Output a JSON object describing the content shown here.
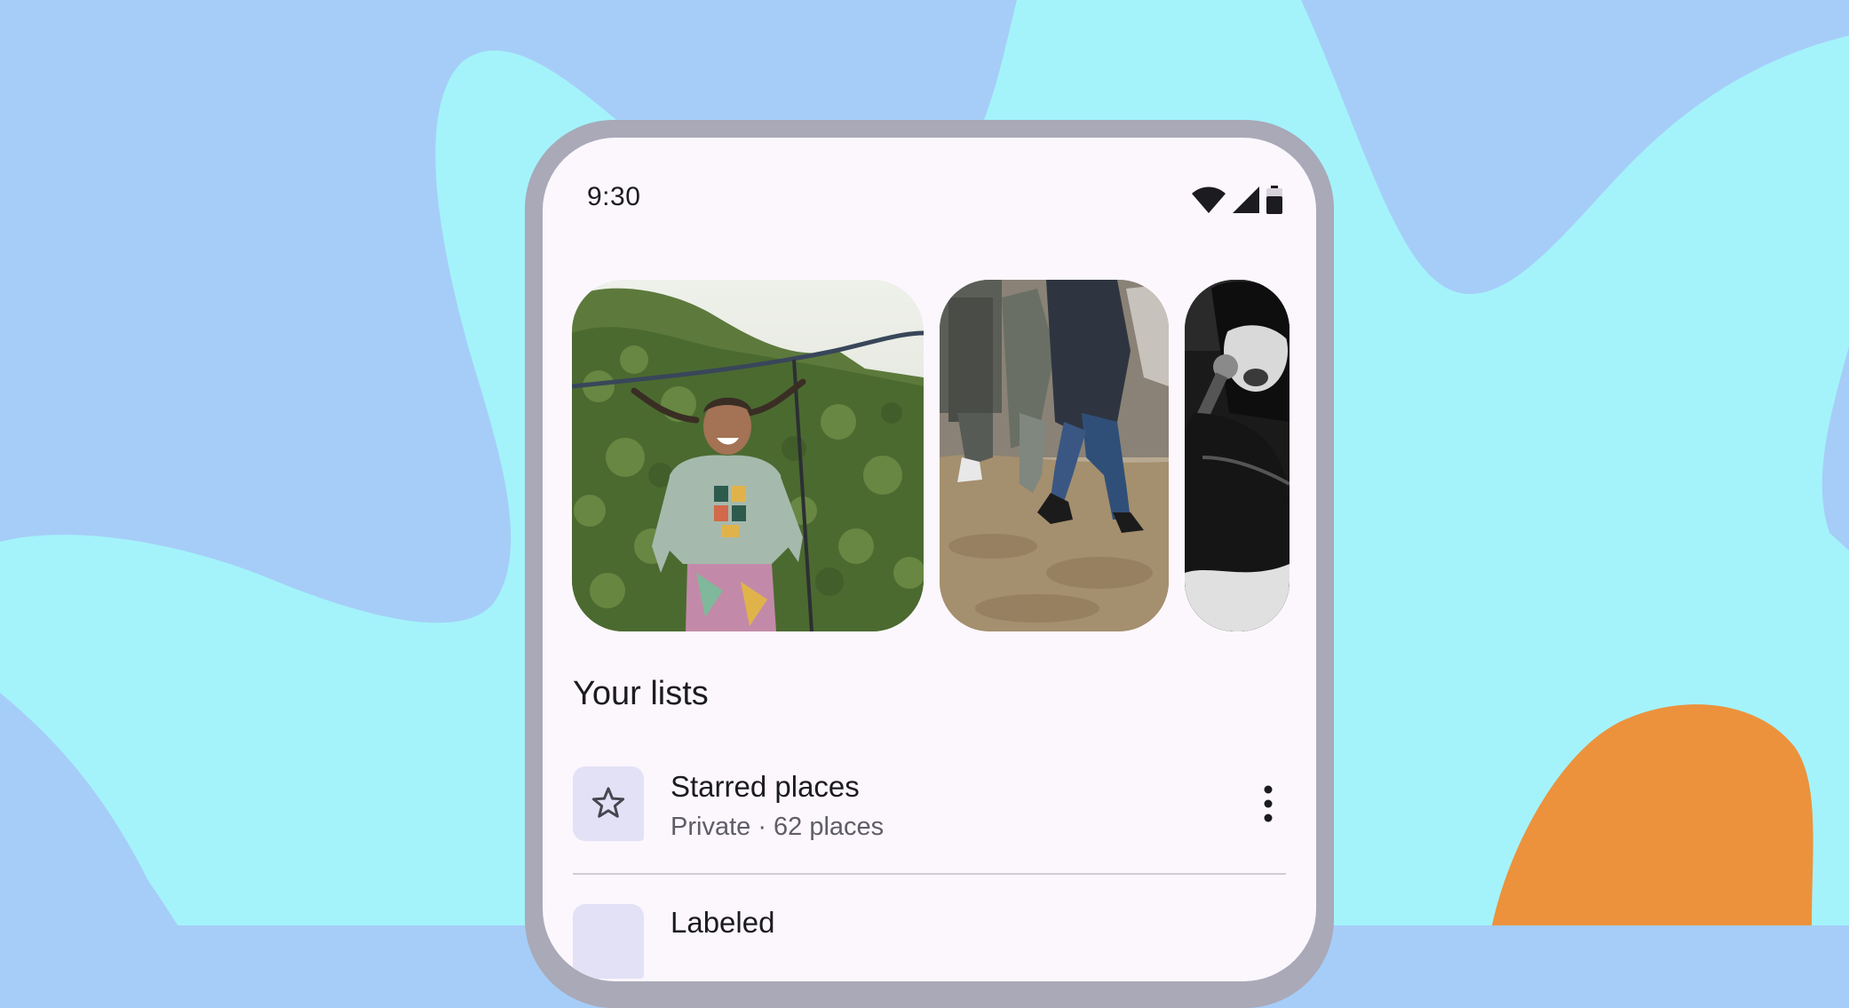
{
  "colors": {
    "background_blue": "#a6cdf7",
    "background_cyan": "#a4f3fb",
    "background_orange": "#ec923c",
    "phone_frame": "#a9a9b8",
    "screen": "#fcf7fd",
    "icon_container": "#e2e1f6"
  },
  "status_bar": {
    "time": "9:30",
    "icons": [
      "wifi-icon",
      "cell-signal-icon",
      "battery-icon"
    ]
  },
  "carousel": {
    "items": [
      {
        "subject": "girl-jumping-photo"
      },
      {
        "subject": "people-dancing-dirt-photo"
      },
      {
        "subject": "singer-microphone-photo"
      }
    ]
  },
  "section": {
    "title": "Your lists"
  },
  "lists": [
    {
      "icon": "star-icon",
      "title": "Starred places",
      "subtitle": "Private · 62 places"
    },
    {
      "icon": "label-icon",
      "title": "Labeled",
      "subtitle": ""
    }
  ]
}
